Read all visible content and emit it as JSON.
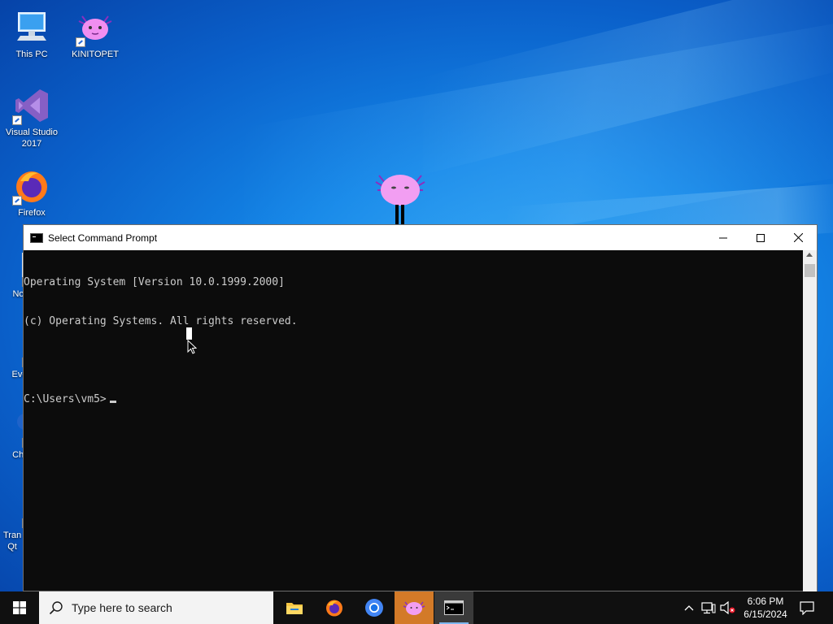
{
  "desktop": {
    "icons": [
      {
        "label": "This PC",
        "icon": "computer-icon"
      },
      {
        "label": "KINITOPET",
        "icon": "axolotl-icon"
      },
      {
        "label": "Visual Studio 2017",
        "icon": "visual-studio-icon"
      },
      {
        "label": "Firefox",
        "icon": "firefox-icon"
      },
      {
        "label": "Not",
        "icon": "notepad-icon"
      },
      {
        "label": "Eve",
        "icon": "event-icon"
      },
      {
        "label": "Chr",
        "icon": "chrome-icon"
      },
      {
        "label": "Tran Qt",
        "icon": "app-icon"
      }
    ]
  },
  "cmd_window": {
    "title": "Select Command Prompt",
    "lines": [
      "Operating System [Version 10.0.1999.2000]",
      "(c) Operating Systems. All rights reserved.",
      "",
      "C:\\Users\\vm5>"
    ],
    "controls": [
      "minimize-icon",
      "maximize-icon",
      "close-icon"
    ]
  },
  "taskbar": {
    "search_placeholder": "Type here to search",
    "apps": [
      "file-explorer-icon",
      "firefox-icon",
      "chrome-icon",
      "kinitopet-icon",
      "command-prompt-icon"
    ],
    "active_app": "kinitopet-icon",
    "time": "6:06 PM",
    "date": "6/15/2024",
    "tray_icons": [
      "chevron-up-icon",
      "network-icon",
      "volume-muted-icon",
      "notifications-icon"
    ]
  },
  "colors": {
    "taskbar_bg": "#101010",
    "active_app_bg": "#d37a28",
    "console_bg": "#0c0c0c",
    "console_text": "#cccccc"
  }
}
